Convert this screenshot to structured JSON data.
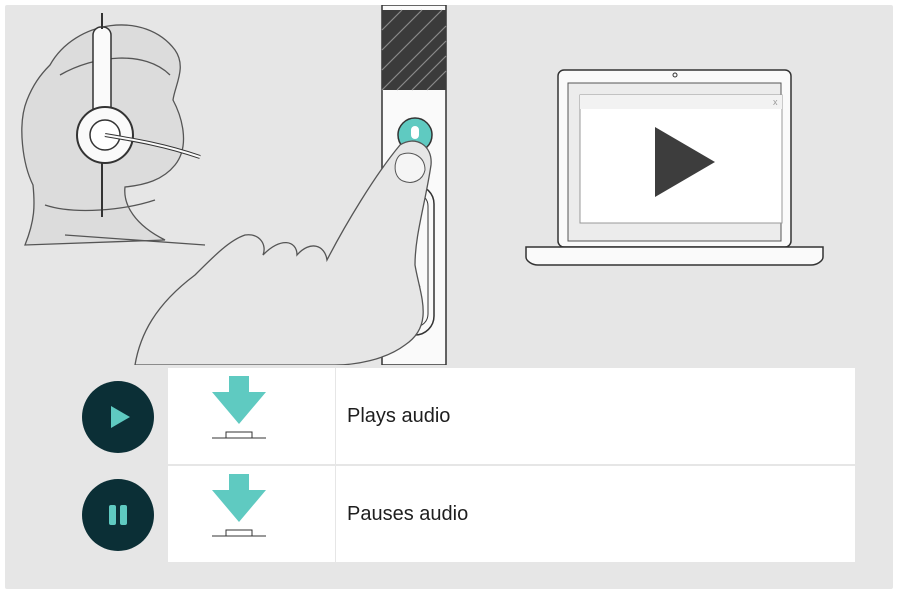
{
  "rows": [
    {
      "state_icon": "play-icon",
      "action_icon": "press-button-icon",
      "label": "Plays audio"
    },
    {
      "state_icon": "pause-icon",
      "action_icon": "press-button-icon",
      "label": "Pauses audio"
    }
  ],
  "colors": {
    "background": "#e6e6e6",
    "icon_circle": "#0b2f36",
    "accent": "#5fcac1",
    "line": "#333333"
  },
  "illustration": {
    "headset": "headset-icon",
    "controller": "in-line-control-unit",
    "laptop": "laptop-icon",
    "video_play": "play-icon",
    "mic_button": "microphone-icon",
    "call_button": "phone-icon"
  }
}
